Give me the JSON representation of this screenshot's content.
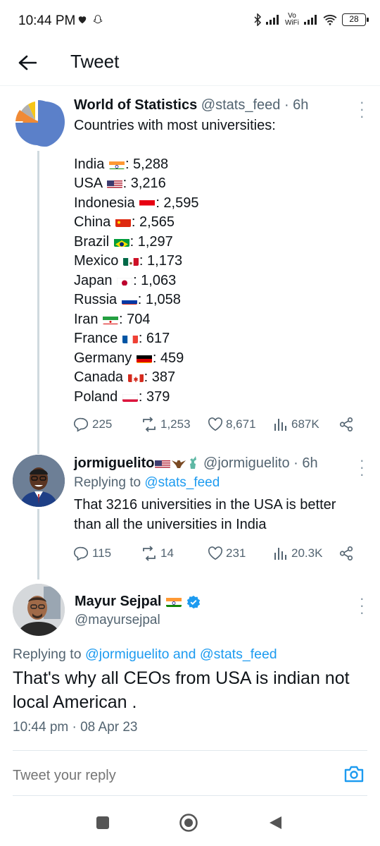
{
  "status_bar": {
    "time": "10:44 PM",
    "battery": "28",
    "network_label": "Vo WiFi"
  },
  "header": {
    "title": "Tweet"
  },
  "thread": [
    {
      "name": "World of Statistics",
      "handle": "@stats_feed",
      "time": "· 6h",
      "intro": "Countries with most universities:",
      "list": [
        {
          "country": "India",
          "flag": "india",
          "value": ": 5,288"
        },
        {
          "country": "USA",
          "flag": "usa",
          "value": ": 3,216"
        },
        {
          "country": "Indonesia",
          "flag": "indonesia",
          "value": ": 2,595"
        },
        {
          "country": "China",
          "flag": "china",
          "value": ": 2,565"
        },
        {
          "country": "Brazil",
          "flag": "brazil",
          "value": ": 1,297"
        },
        {
          "country": "Mexico",
          "flag": "mexico",
          "value": ": 1,173"
        },
        {
          "country": "Japan",
          "flag": "japan",
          "value": ": 1,063"
        },
        {
          "country": "Russia",
          "flag": "russia",
          "value": ": 1,058"
        },
        {
          "country": "Iran",
          "flag": "iran",
          "value": ": 704"
        },
        {
          "country": "France",
          "flag": "france",
          "value": ": 617"
        },
        {
          "country": "Germany",
          "flag": "germany",
          "value": ": 459"
        },
        {
          "country": "Canada",
          "flag": "canada",
          "value": ": 387"
        },
        {
          "country": "Poland",
          "flag": "poland",
          "value": ": 379"
        }
      ],
      "stats": {
        "replies": "225",
        "retweets": "1,253",
        "likes": "8,671",
        "views": "687K"
      }
    },
    {
      "name": "jormiguelito",
      "handle": "@jormiguelito",
      "time": "· 6h",
      "replying_label": "Replying to ",
      "replying_to": "@stats_feed",
      "text": "That 3216 universities in the USA is better than all the universities in India",
      "stats": {
        "replies": "115",
        "retweets": "14",
        "likes": "231",
        "views": "20.3K"
      }
    }
  ],
  "main_tweet": {
    "name": "Mayur Sejpal",
    "handle": "@mayursejpal",
    "replying_label": "Replying to ",
    "replying_to_1": "@jormiguelito",
    "replying_and": " and ",
    "replying_to_2": "@stats_feed",
    "text": "That's why all CEOs from USA is indian not local American .",
    "timestamp": "10:44 pm · 08 Apr 23"
  },
  "reply_bar": {
    "placeholder": "Tweet your reply"
  },
  "colors": {
    "link": "#1d9bf0",
    "muted": "#536471",
    "text": "#0f1419",
    "thread_line": "#cfd9de"
  }
}
